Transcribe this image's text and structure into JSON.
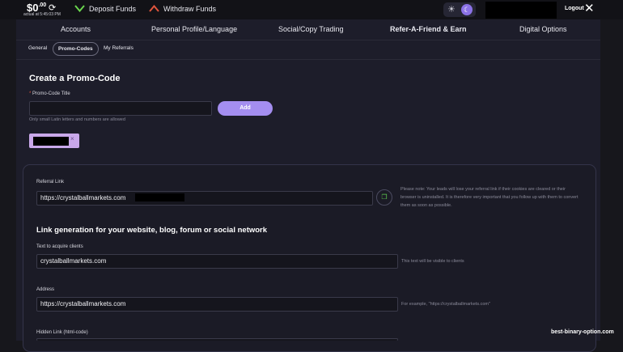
{
  "topbar": {
    "balance_main": "$0",
    "balance_cents": ".00",
    "balance_sub": "actual at 5:45:03 PM",
    "deposit_label": "Deposit Funds",
    "withdraw_label": "Withdraw Funds",
    "logout_label": "Logout"
  },
  "nav": {
    "items": [
      "Accounts",
      "Personal Profile/Language",
      "Social/Copy Trading",
      "Refer-A-Friend & Earn",
      "Digital Options"
    ],
    "active": "Refer-A-Friend & Earn"
  },
  "subtabs": {
    "items": [
      "General",
      "Promo-Codes",
      "My Referrals"
    ],
    "active": "Promo-Codes"
  },
  "promo": {
    "heading": "Create a Promo-Code",
    "required_mark": "*",
    "field_label": "Promo-Code Title",
    "field_value": "",
    "add_label": "Add",
    "hint": "Only small Latin letters and numbers are allowed",
    "chip_remove": "×"
  },
  "referral": {
    "label": "Referral Link",
    "value": "https://crystalballmarkets.com",
    "note": "Please note: Your leads will lose your referral link if their cookies are cleared or their browser is uninstalled. It is therefore very important that you follow up with them to convert them as soon as possible."
  },
  "generator": {
    "heading": "Link generation for your website, blog, forum or social network",
    "text_label": "Text to acquire clients",
    "text_value": "crystalballmarkets.com",
    "text_hint": "This text will be visible to clients",
    "address_label": "Address",
    "address_value": "https://crystalballmarkets.com",
    "address_hint": "For example, \"https://crystalballmarkets.com\"",
    "hidden_label": "Hidden Link (html-code)"
  },
  "watermark": "best-binary-option.com",
  "colors": {
    "background": "#17171c",
    "panel": "#1d1d2a",
    "accent": "#a48ef0",
    "deposit_icon": "#6ad64d",
    "withdraw_icon": "#e0553d"
  },
  "icons": [
    "refresh-icon",
    "deposit-chevron-icon",
    "withdraw-chevron-icon",
    "sun-icon",
    "moon-icon",
    "close-icon",
    "copy-icon"
  ]
}
